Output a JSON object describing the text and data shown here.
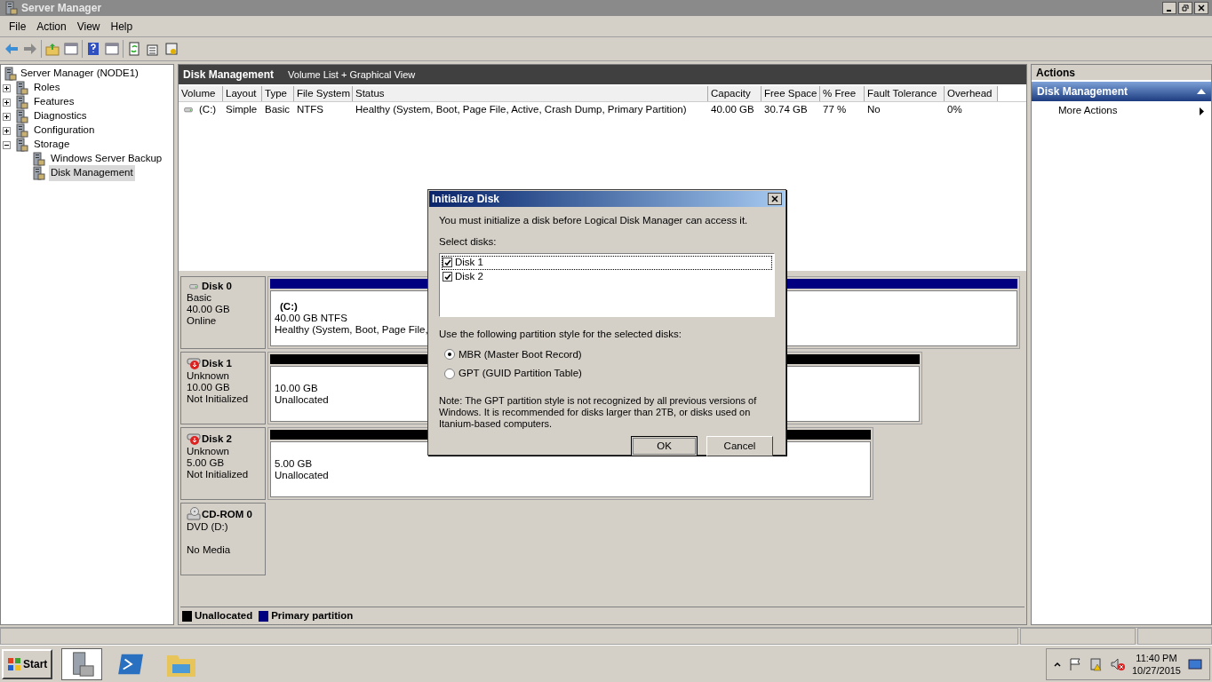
{
  "window": {
    "title": "Server Manager"
  },
  "menu": [
    "File",
    "Action",
    "View",
    "Help"
  ],
  "tree": {
    "label": "Server Manager (NODE1)",
    "children": [
      {
        "label": "Roles",
        "expanded": false,
        "selected": false
      },
      {
        "label": "Features",
        "expanded": false,
        "selected": false
      },
      {
        "label": "Diagnostics",
        "expanded": false,
        "selected": false
      },
      {
        "label": "Configuration",
        "expanded": false,
        "selected": false
      },
      {
        "label": "Storage",
        "expanded": true,
        "selected": false,
        "children": [
          {
            "label": "Windows Server Backup",
            "selected": false
          },
          {
            "label": "Disk Management",
            "selected": true
          }
        ]
      }
    ]
  },
  "center": {
    "title": "Disk Management",
    "subtitle": "Volume List + Graphical View",
    "columns": [
      "Volume",
      "Layout",
      "Type",
      "File System",
      "Status",
      "Capacity",
      "Free Space",
      "% Free",
      "Fault Tolerance",
      "Overhead"
    ],
    "rows": [
      [
        "(C:)",
        "Simple",
        "Basic",
        "NTFS",
        "Healthy (System, Boot, Page File, Active, Crash Dump, Primary Partition)",
        "40.00 GB",
        "30.74 GB",
        "77 %",
        "No",
        "0%"
      ]
    ]
  },
  "disks": [
    {
      "name": "Disk 0",
      "kind": "online",
      "type": "Basic",
      "size": "40.00 GB",
      "status": "Online",
      "partitions": [
        {
          "kind": "primary",
          "label": "(C:)",
          "lines": [
            "40.00 GB NTFS",
            "Healthy (System, Boot, Page File,"
          ]
        }
      ]
    },
    {
      "name": "Disk 1",
      "kind": "not_initialized",
      "type": "Unknown",
      "size": "10.00 GB",
      "status": "Not Initialized",
      "partitions": [
        {
          "kind": "unallocated",
          "lines": [
            "10.00 GB",
            "Unallocated"
          ]
        }
      ]
    },
    {
      "name": "Disk 2",
      "kind": "not_initialized",
      "type": "Unknown",
      "size": "5.00 GB",
      "status": "Not Initialized",
      "partitions": [
        {
          "kind": "unallocated",
          "lines": [
            "5.00 GB",
            "Unallocated"
          ]
        }
      ]
    },
    {
      "name": "CD-ROM 0",
      "kind": "cdrom",
      "type": "DVD (D:)",
      "status": "No Media"
    }
  ],
  "legend": [
    {
      "label": "Unallocated",
      "color": "#000000"
    },
    {
      "label": "Primary partition",
      "color": "#000080"
    }
  ],
  "actions": {
    "title": "Actions",
    "section": "Disk Management",
    "items": [
      "More Actions"
    ]
  },
  "dialog": {
    "title": "Initialize Disk",
    "message": "You must initialize a disk before Logical Disk Manager can access it.",
    "select_label": "Select disks:",
    "disks": [
      {
        "label": "Disk 1",
        "checked": true
      },
      {
        "label": "Disk 2",
        "checked": true
      }
    ],
    "style_label": "Use the following partition style for the selected disks:",
    "styles": [
      {
        "label": "MBR (Master Boot Record)",
        "selected": true
      },
      {
        "label": "GPT (GUID Partition Table)",
        "selected": false
      }
    ],
    "note": "Note: The GPT partition style is not recognized by all previous versions of Windows. It is recommended for disks larger than 2TB, or disks used on Itanium-based computers.",
    "buttons": [
      "OK",
      "Cancel"
    ]
  },
  "taskbar": {
    "start": "Start",
    "time": "11:40 PM",
    "date": "10/27/2015"
  }
}
